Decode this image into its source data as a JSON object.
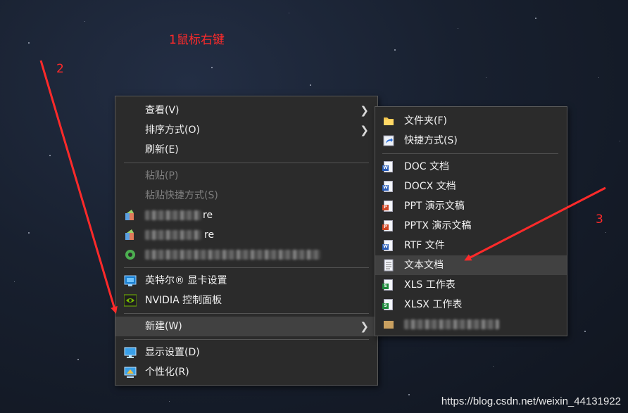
{
  "annotations": {
    "step1": "1鼠标右键",
    "step2": "2",
    "step3": "3"
  },
  "context_menu": {
    "items": [
      {
        "label": "查看(V)",
        "has_submenu": true,
        "enabled": true
      },
      {
        "label": "排序方式(O)",
        "has_submenu": true,
        "enabled": true
      },
      {
        "label": "刷新(E)",
        "enabled": true
      },
      {
        "label": "粘贴(P)",
        "enabled": false
      },
      {
        "label": "粘贴快捷方式(S)",
        "enabled": false
      },
      {
        "label": "re",
        "enabled": true,
        "icon": "app-icon",
        "partially_obscured": true
      },
      {
        "label": "re",
        "enabled": true,
        "icon": "app-icon",
        "partially_obscured": true
      },
      {
        "label": "",
        "enabled": true,
        "icon": "app-icon",
        "partially_obscured": true
      },
      {
        "label": "英特尔® 显卡设置",
        "enabled": true,
        "icon": "intel-graphics-icon"
      },
      {
        "label": "NVIDIA 控制面板",
        "enabled": true,
        "icon": "nvidia-icon"
      },
      {
        "label": "新建(W)",
        "has_submenu": true,
        "enabled": true,
        "highlighted": true
      },
      {
        "label": "显示设置(D)",
        "enabled": true,
        "icon": "display-icon"
      },
      {
        "label": "个性化(R)",
        "enabled": true,
        "icon": "personalize-icon"
      }
    ]
  },
  "new_submenu": {
    "items": [
      {
        "label": "文件夹(F)",
        "icon": "folder-icon"
      },
      {
        "label": "快捷方式(S)",
        "icon": "shortcut-icon"
      },
      {
        "label": "DOC 文档",
        "icon": "word-doc-icon",
        "tag": "W",
        "color": "#2b5eb8"
      },
      {
        "label": "DOCX 文档",
        "icon": "word-docx-icon",
        "tag": "W",
        "color": "#2b5eb8"
      },
      {
        "label": "PPT 演示文稿",
        "icon": "ppt-icon",
        "tag": "P",
        "color": "#d24726"
      },
      {
        "label": "PPTX 演示文稿",
        "icon": "pptx-icon",
        "tag": "P",
        "color": "#d24726"
      },
      {
        "label": "RTF 文件",
        "icon": "rtf-icon",
        "tag": "W",
        "color": "#2b5eb8"
      },
      {
        "label": "文本文档",
        "icon": "text-doc-icon",
        "highlighted": true
      },
      {
        "label": "XLS 工作表",
        "icon": "xls-icon",
        "tag": "S",
        "color": "#1e8a3c"
      },
      {
        "label": "XLSX 工作表",
        "icon": "xlsx-icon",
        "tag": "S",
        "color": "#1e8a3c"
      },
      {
        "label": "",
        "icon": "app-icon",
        "partially_obscured": true
      }
    ]
  },
  "watermark": "https://blog.csdn.net/weixin_44131922",
  "colors": {
    "annotation_red": "#ff2a2a",
    "menu_bg": "#2b2b2b",
    "highlight_bg": "#414141"
  }
}
